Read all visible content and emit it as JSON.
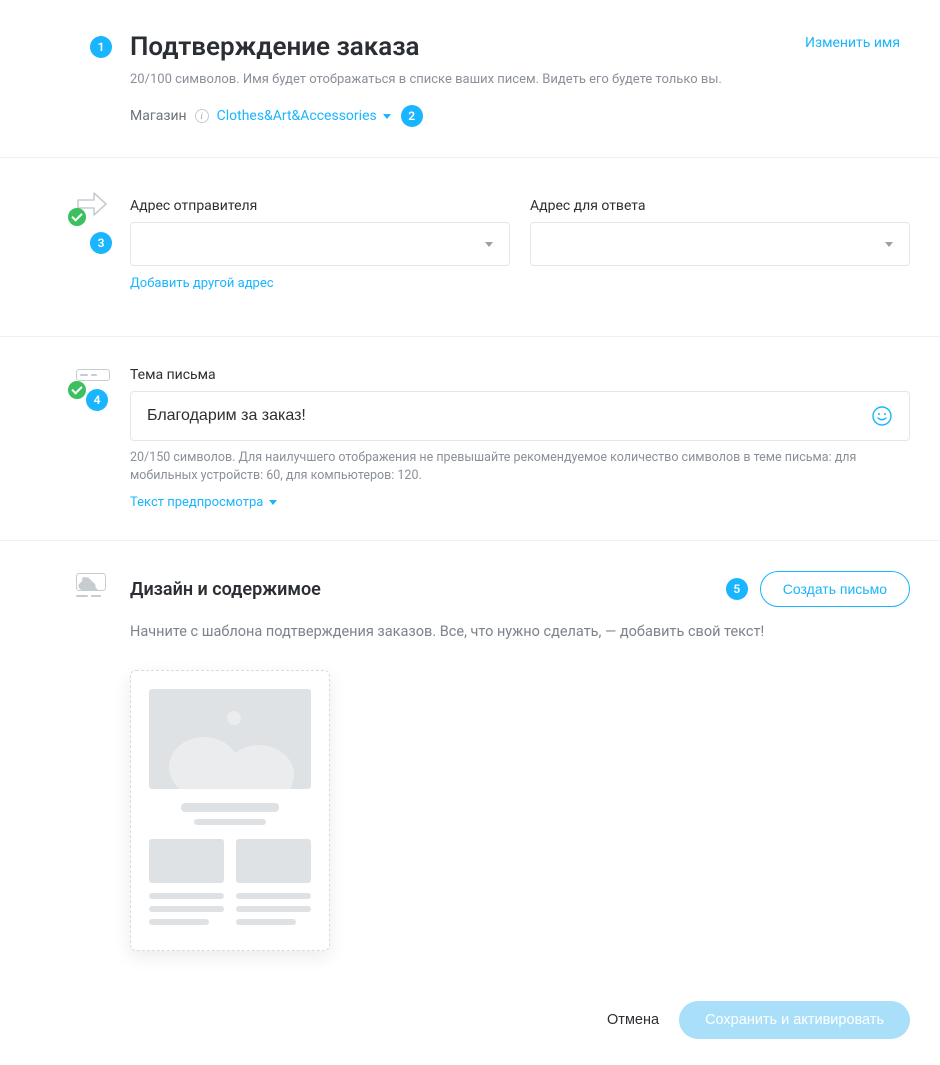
{
  "header": {
    "title": "Подтверждение заказа",
    "counter": "20/100 символов.",
    "subtitle_rest": "Имя будет отображаться в списке ваших писем. Видеть его будете только вы.",
    "change_name": "Изменить имя",
    "store_label": "Магазин",
    "store_selected": "Clothes&Art&Accessories"
  },
  "badges": {
    "b1": "1",
    "b2": "2",
    "b3": "3",
    "b4": "4",
    "b5": "5"
  },
  "addresses": {
    "sender_label": "Адрес отправителя",
    "reply_label": "Адрес для ответа",
    "add_another": "Добавить другой адрес"
  },
  "subject": {
    "label": "Тема письма",
    "value": "Благодарим за заказ!",
    "helper": "20/150 символов. Для наилучшего отображения не превышайте рекомендуемое количество символов в теме письма: для мобильных устройств: 60, для компьютеров: 120.",
    "preview_link": "Текст предпросмотра"
  },
  "design": {
    "title": "Дизайн и содержимое",
    "create_button": "Создать письмо",
    "subtitle": "Начните с шаблона подтверждения заказов. Все, что нужно сделать, — добавить свой текст!"
  },
  "footer": {
    "cancel": "Отмена",
    "save": "Сохранить и активировать"
  }
}
